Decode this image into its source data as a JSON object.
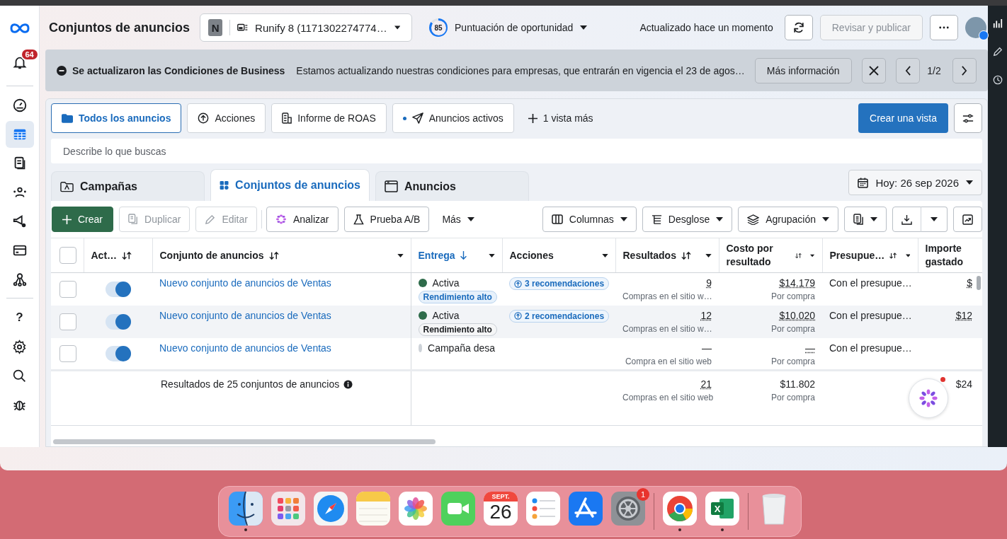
{
  "header": {
    "title": "Conjuntos de anuncios",
    "account": {
      "initial": "N",
      "name": "Runify 8 (1171302274774…"
    },
    "score": {
      "value": "85",
      "level": 0.85,
      "label": "Puntuación de oportunidad"
    },
    "updated": "Actualizado hace un momento",
    "publish": {
      "label": "Revisar y publicar",
      "disabled": true
    }
  },
  "sidebar": {
    "notifications": "64",
    "items": [
      {
        "selected": false
      },
      {
        "selected": true
      },
      {
        "selected": false
      },
      {
        "selected": false
      },
      {
        "selected": false
      },
      {
        "selected": false
      },
      {
        "selected": false
      }
    ],
    "help": "?"
  },
  "banner": {
    "title": "Se actualizaron las Condiciones de Business",
    "text": "Estamos actualizando nuestras condiciones para empresas, que entrarán en vigencia el 23 de agos…",
    "button": "Más información",
    "pager": "1/2"
  },
  "views": {
    "tabs": [
      {
        "label": "Todos los anuncios",
        "selected": true
      },
      {
        "label": "Acciones",
        "selected": false
      },
      {
        "label": "Informe de ROAS",
        "selected": false
      },
      {
        "label": "Anuncios activos",
        "selected": false
      }
    ],
    "more": "1 vista más",
    "create": "Crear una vista",
    "search_placeholder": "Describe lo que buscas"
  },
  "levels": {
    "tabs": [
      {
        "label": "Campañas",
        "selected": false
      },
      {
        "label": "Conjuntos de anuncios",
        "selected": true
      },
      {
        "label": "Anuncios",
        "selected": false
      }
    ],
    "date": "Hoy: 26 sep 2026"
  },
  "toolbar": {
    "left": [
      {
        "label": "Crear",
        "kind": "primary",
        "disabled": false
      },
      {
        "label": "Duplicar",
        "kind": "default",
        "disabled": true
      },
      {
        "label": "Editar",
        "kind": "default",
        "disabled": true
      },
      {
        "label": "Analizar",
        "kind": "default",
        "disabled": false
      },
      {
        "label": "Prueba A/B",
        "kind": "default",
        "disabled": false
      },
      {
        "label": "Más",
        "kind": "menu",
        "disabled": false
      }
    ],
    "right": [
      {
        "label": "Columnas"
      },
      {
        "label": "Desglose"
      },
      {
        "label": "Agrupación"
      }
    ]
  },
  "table": {
    "select_all_checked": false,
    "columns": [
      {
        "label": "Act…",
        "sortable": true,
        "menu": false,
        "selected": false
      },
      {
        "label": "Conjunto de anuncios",
        "sortable": true,
        "menu": true,
        "selected": false
      },
      {
        "label": "Entrega",
        "sortable": false,
        "menu": true,
        "selected": true
      },
      {
        "label": "Acciones",
        "sortable": false,
        "menu": true,
        "selected": false
      },
      {
        "label": "Resultados",
        "sortable": true,
        "menu": true,
        "selected": false
      },
      {
        "label": "Costo por resultado",
        "sortable": true,
        "menu": true,
        "selected": false
      },
      {
        "label": "Presupue…",
        "sortable": true,
        "menu": true,
        "selected": false
      },
      {
        "label": "Importe gastado",
        "sortable": false,
        "menu": false,
        "selected": false
      }
    ],
    "rows": [
      {
        "checked": false,
        "on": true,
        "hovered": false,
        "name": "Nuevo conjunto de anuncios de Ventas",
        "status": "Activa",
        "color": "#2e6b4a",
        "badge": "Rendimiento alto",
        "badge_highlighted": true,
        "actions": "3 recomendaciones",
        "results": "9",
        "results_sub": "Compras en el sitio w…",
        "cost": "$14.179",
        "cost_sub": "Por compra",
        "budget": "Con el presupue…",
        "spent": "$"
      },
      {
        "checked": false,
        "on": true,
        "hovered": true,
        "name": "Nuevo conjunto de anuncios de Ventas",
        "status": "Activa",
        "color": "#2e6b4a",
        "badge": "Rendimiento alto",
        "badge_highlighted": false,
        "actions": "2 recomendaciones",
        "results": "12",
        "results_sub": "Compras en el sitio w…",
        "cost": "$10.020",
        "cost_sub": "Por compra",
        "budget": "Con el presupue…",
        "spent": "$12"
      },
      {
        "checked": false,
        "on": true,
        "hovered": false,
        "name": "Nuevo conjunto de anuncios de Ventas",
        "status": "Campaña desa",
        "color": "#cdd2d8",
        "actions": "",
        "results": "—",
        "results_sub": "Compra en el sitio web",
        "cost": "—",
        "cost_sub": "Por compra",
        "budget": "Con el presupue…",
        "spent": ""
      }
    ],
    "totals": {
      "label": "Resultados de 25 conjuntos de anuncios",
      "results": "21",
      "results_sub": "Compras en el sitio web",
      "cost": "$11.802",
      "cost_sub": "Por compra",
      "spent": "$24"
    }
  },
  "dock": {
    "apps": [
      {
        "kind": "finder",
        "running": true
      },
      {
        "kind": "launchpad",
        "running": false
      },
      {
        "kind": "safari",
        "running": false
      },
      {
        "kind": "notes",
        "running": false
      },
      {
        "kind": "photos",
        "running": false
      },
      {
        "kind": "facetime",
        "running": false
      },
      {
        "kind": "calendar",
        "running": false,
        "month": "SEPT.",
        "day": "26"
      },
      {
        "kind": "reminders",
        "running": false
      },
      {
        "kind": "appstore",
        "running": false
      },
      {
        "kind": "settings",
        "running": false,
        "badge": "1"
      },
      {
        "kind": "separator"
      },
      {
        "kind": "chrome",
        "running": true
      },
      {
        "kind": "excel",
        "running": true,
        "letter": "X"
      },
      {
        "kind": "separator"
      },
      {
        "kind": "trash",
        "running": false
      }
    ]
  }
}
